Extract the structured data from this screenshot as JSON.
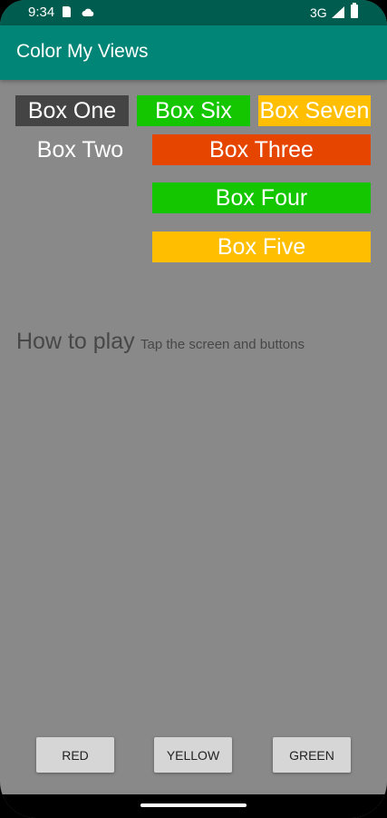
{
  "status_bar": {
    "time": "9:34",
    "network": "3G"
  },
  "app_bar": {
    "title": "Color My Views"
  },
  "boxes": {
    "one": {
      "label": "Box One",
      "color": "#444444"
    },
    "two": {
      "label": "Box Two",
      "color": "transparent"
    },
    "three": {
      "label": "Box Three",
      "color": "#E64500"
    },
    "four": {
      "label": "Box Four",
      "color": "#14C600"
    },
    "five": {
      "label": "Box Five",
      "color": "#FFBF00"
    },
    "six": {
      "label": "Box Six",
      "color": "#14C600"
    },
    "seven": {
      "label": "Box Seven",
      "color": "#FFBF00"
    }
  },
  "how_to": {
    "label": "How to play",
    "text": "Tap the screen and buttons"
  },
  "buttons": {
    "red": "RED",
    "yellow": "YELLOW",
    "green": "GREEN"
  },
  "colors": {
    "background": "#898989",
    "app_bar": "#008577",
    "status_bar": "#005C4F"
  }
}
